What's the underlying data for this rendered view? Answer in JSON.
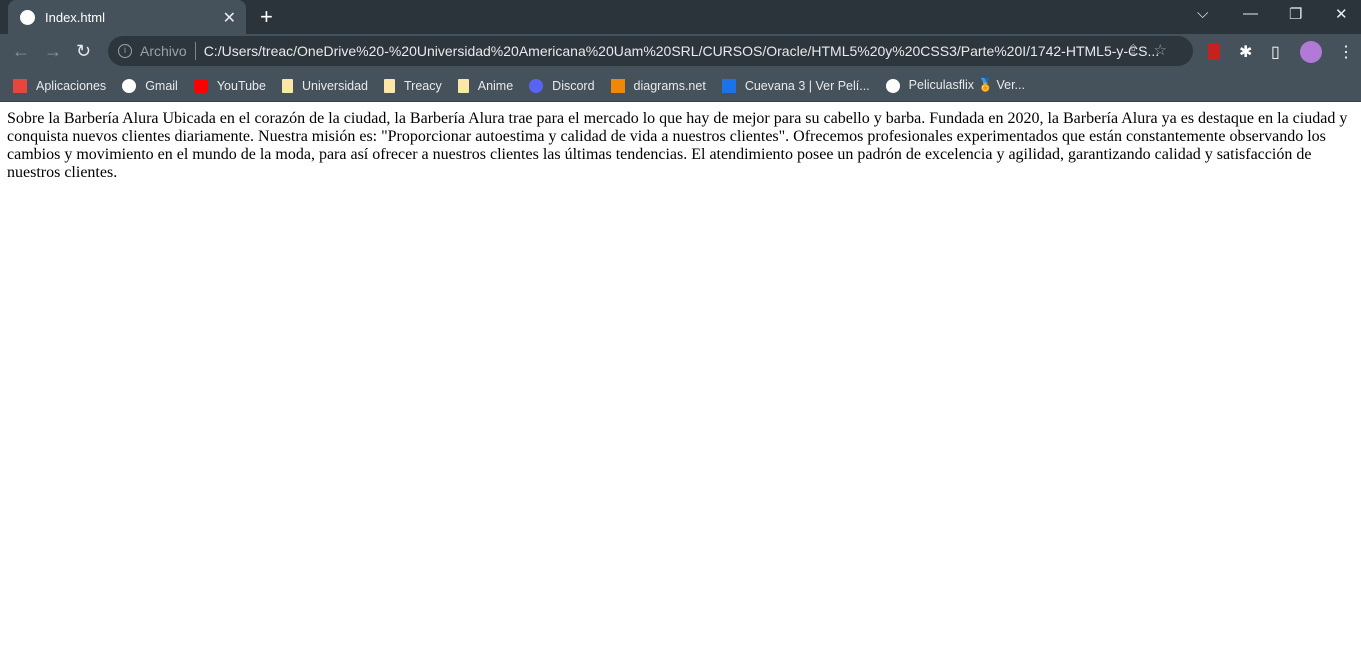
{
  "tab": {
    "title": "Index.html",
    "close": "✕",
    "new_tab": "+"
  },
  "window": {
    "dropdown": "⌵",
    "minimize": "—",
    "restore": "❐",
    "close": "✕"
  },
  "toolbar": {
    "back": "←",
    "forward": "→",
    "reload": "↻",
    "scheme_label": "Archivo",
    "url": "C:/Users/treac/OneDrive%20-%20Universidad%20Americana%20Uam%20SRL/CURSOS/Oracle/HTML5%20y%20CSS3/Parte%20I/1742-HTML5-y-CS...",
    "share": "⇪",
    "star": "☆",
    "extensions": "✱",
    "sidepanel": "▯",
    "menu": "⋮"
  },
  "bookmarks": [
    {
      "label": "Aplicaciones",
      "icon": "apps-grid-icon",
      "color": "#e8453c"
    },
    {
      "label": "Gmail",
      "icon": "globe-icon",
      "color": "#ffffff"
    },
    {
      "label": "YouTube",
      "icon": "youtube-icon",
      "color": "#ff0000"
    },
    {
      "label": "Universidad",
      "icon": "folder-icon",
      "color": "#fce8a6"
    },
    {
      "label": "Treacy",
      "icon": "folder-icon",
      "color": "#fce8a6"
    },
    {
      "label": "Anime",
      "icon": "folder-icon",
      "color": "#fce8a6"
    },
    {
      "label": "Discord",
      "icon": "discord-icon",
      "color": "#5865f2"
    },
    {
      "label": "diagrams.net",
      "icon": "diagrams-icon",
      "color": "#f08705"
    },
    {
      "label": "Cuevana 3 | Ver Pelí...",
      "icon": "cuevana-icon",
      "color": "#1a73e8"
    },
    {
      "label": "Peliculasflix 🏅 Ver...",
      "icon": "globe-icon",
      "color": "#ffffff"
    }
  ],
  "page": {
    "text": "Sobre la Barbería Alura Ubicada en el corazón de la ciudad, la Barbería Alura trae para el mercado lo que hay de mejor para su cabello y barba. Fundada en 2020, la Barbería Alura ya es destaque en la ciudad y conquista nuevos clientes diariamente. Nuestra misión es: \"Proporcionar autoestima y calidad de vida a nuestros clientes\". Ofrecemos profesionales experimentados que están constantemente observando los cambios y movimiento en el mundo de la moda, para así ofrecer a nuestros clientes las últimas tendencias. El atendimiento posee un padrón de excelencia y agilidad, garantizando calidad y satisfacción de nuestros clientes."
  }
}
